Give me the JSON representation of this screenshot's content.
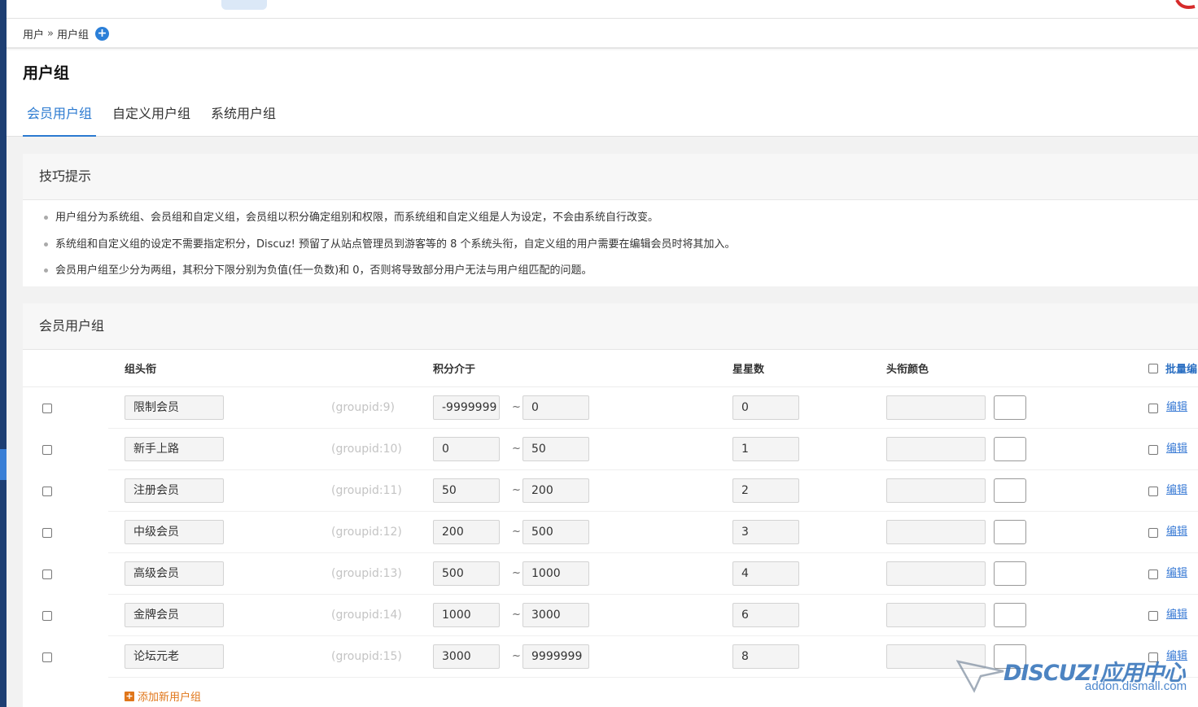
{
  "breadcrumb": {
    "root": "用户",
    "sep": "»",
    "current": "用户组"
  },
  "page_title": "用户组",
  "tabs": [
    "会员用户组",
    "自定义用户组",
    "系统用户组"
  ],
  "tips": {
    "title": "技巧提示",
    "items": [
      "用户组分为系统组、会员组和自定义组，会员组以积分确定组别和权限，而系统组和自定义组是人为设定，不会由系统自行改变。",
      "系统组和自定义组的设定不需要指定积分，Discuz! 预留了从站点管理员到游客等的 8 个系统头衔，自定义组的用户需要在编辑会员时将其加入。",
      "会员用户组至少分为两组，其积分下限分别为负值(任一负数)和 0，否则将导致部分用户无法与用户组匹配的问题。"
    ]
  },
  "groups": {
    "title": "会员用户组",
    "headers": {
      "title": "组头衔",
      "range": "积分介于",
      "stars": "星星数",
      "color": "头衔颜色",
      "batch": "批量编"
    },
    "tilde": "~",
    "edit_label": "编辑",
    "rows": [
      {
        "name": "限制会员",
        "gid": "(groupid:9)",
        "min": "-9999999",
        "max": "0",
        "stars": "0"
      },
      {
        "name": "新手上路",
        "gid": "(groupid:10)",
        "min": "0",
        "max": "50",
        "stars": "1"
      },
      {
        "name": "注册会员",
        "gid": "(groupid:11)",
        "min": "50",
        "max": "200",
        "stars": "2"
      },
      {
        "name": "中级会员",
        "gid": "(groupid:12)",
        "min": "200",
        "max": "500",
        "stars": "3"
      },
      {
        "name": "高级会员",
        "gid": "(groupid:13)",
        "min": "500",
        "max": "1000",
        "stars": "4"
      },
      {
        "name": "金牌会员",
        "gid": "(groupid:14)",
        "min": "1000",
        "max": "3000",
        "stars": "6"
      },
      {
        "name": "论坛元老",
        "gid": "(groupid:15)",
        "min": "3000",
        "max": "9999999",
        "stars": "8"
      }
    ],
    "add_label": "添加新用户组"
  },
  "watermark": {
    "brand": "DISCUZ!应用中心",
    "url": "addon.dismall.com"
  },
  "colors": {
    "accent": "#2b7ad0",
    "add_link": "#e0761a",
    "sidebar": "#1e3f73"
  }
}
